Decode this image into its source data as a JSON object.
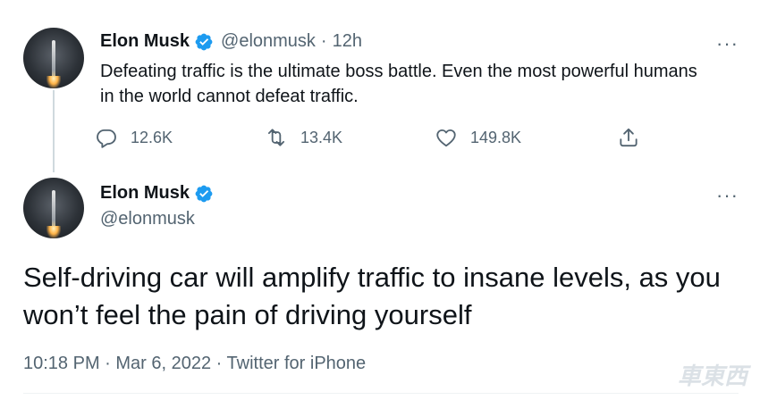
{
  "tweet1": {
    "name": "Elon Musk",
    "handle": "@elonmusk",
    "separator": "·",
    "time": "12h",
    "text": "Defeating traffic is the ultimate boss battle. Even the most powerful humans in the world cannot defeat traffic.",
    "replies": "12.6K",
    "retweets": "13.4K",
    "likes": "149.8K",
    "more": "···"
  },
  "tweet2": {
    "name": "Elon Musk",
    "handle": "@elonmusk",
    "more": "···",
    "text": "Self-driving car will amplify traffic to insane levels, as you won’t feel the pain of driving yourself",
    "meta": "10:18 PM · Mar 6, 2022 · Twitter for iPhone"
  },
  "watermark": "車東西",
  "colors": {
    "verified": "#1d9bf0",
    "text": "#0f1419",
    "muted": "#536471",
    "thread_line": "#cfd9de"
  },
  "icons": [
    "reply-icon",
    "retweet-icon",
    "like-icon",
    "share-icon",
    "verified-badge-icon",
    "more-icon"
  ]
}
